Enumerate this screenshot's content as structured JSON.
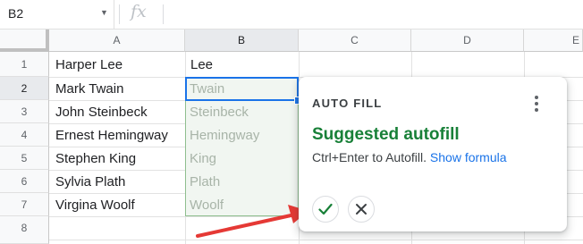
{
  "formula_bar": {
    "cell_ref": "B2",
    "fx_label": "fx"
  },
  "columns": [
    "A",
    "B",
    "C",
    "D",
    "E"
  ],
  "rows": [
    "1",
    "2",
    "3",
    "4",
    "5",
    "6",
    "7",
    "8"
  ],
  "names": [
    "Harper Lee",
    "Mark Twain",
    "John Steinbeck",
    "Ernest Hemingway",
    "Stephen King",
    "Sylvia Plath",
    "Virgina Woolf"
  ],
  "b_col": {
    "entered": "Lee",
    "suggestions": [
      "Twain",
      "Steinbeck",
      "Hemingway",
      "King",
      "Plath",
      "Woolf"
    ]
  },
  "popup": {
    "title": "AUTO FILL",
    "heading": "Suggested autofill",
    "hint": "Ctrl+Enter to Autofill.",
    "link": "Show formula"
  },
  "colors": {
    "accent": "#1a73e8",
    "suggest_green": "#188038",
    "arrow_red": "#e53935"
  }
}
